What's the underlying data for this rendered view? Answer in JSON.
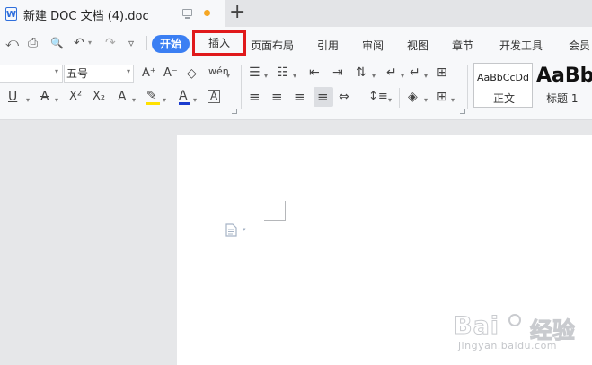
{
  "window": {
    "doc_title": "新建 DOC 文档 (4).doc",
    "doc_icon": "W",
    "new_tab": "+"
  },
  "quick_access": {
    "save": "⤺",
    "print": "⎙",
    "print_preview": "🔍",
    "undo": "↶",
    "redo": "↷",
    "more": "▿",
    "dd": "▾"
  },
  "menu": {
    "tabs": [
      "开始",
      "插入",
      "页面布局",
      "引用",
      "审阅",
      "视图",
      "章节",
      "开发工具",
      "会员"
    ],
    "active_tab": "开始",
    "highlighted_tab": "插入",
    "active_color": "#3b7ff3",
    "highlight_box_color": "#e0191b"
  },
  "ribbon": {
    "font_size": "五号",
    "grow_font": "A⁺",
    "shrink_font": "A⁻",
    "clear_format": "◇",
    "phonetic": "wén",
    "underline": "U",
    "strike": "A",
    "superscript": "X²",
    "subscript": "X₂",
    "text_effect": "A",
    "highlight": "✎",
    "font_color": "A",
    "char_border": "A",
    "bullets": "☰",
    "numbering": "☷",
    "outdent": "⇤",
    "indent": "⇥",
    "sort": "⇅",
    "show_marks": "↵",
    "ruler": "⊞",
    "align_left": "≡",
    "align_center": "≡",
    "align_right": "≡",
    "align_justify": "≡",
    "distribute": "⇔",
    "line_spacing": "↕≡",
    "shading": "◈",
    "borders": "⊞",
    "highlight_color": "#ffe100",
    "font_color_value": "#1a3ccf"
  },
  "styles": {
    "normal_preview": "AaBbCcDd",
    "normal_label": "正文",
    "h1_preview": "AaBb",
    "h1_label": "标题 1"
  },
  "watermark": {
    "logo": "Bai",
    "logo2": "经验",
    "url": "jingyan.baidu.com"
  }
}
